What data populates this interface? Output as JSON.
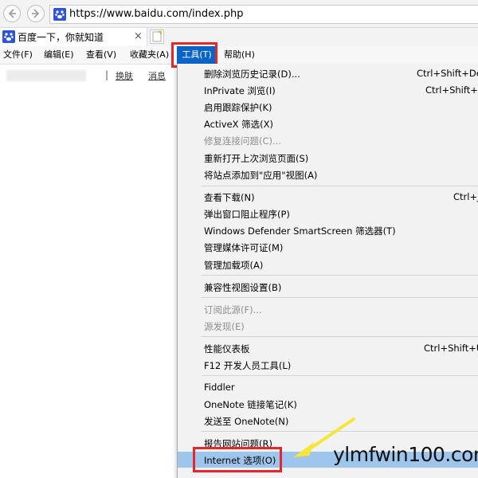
{
  "address_bar": {
    "url": "https://www.baidu.com/index.php"
  },
  "tab": {
    "title": "百度一下，你就知道",
    "close": "×"
  },
  "menubar": [
    {
      "label": "文件(F)"
    },
    {
      "label": "编辑(E)"
    },
    {
      "label": "查看(V)"
    },
    {
      "label": "收藏夹(A)"
    },
    {
      "label": "工具(T)"
    },
    {
      "label": "帮助(H)"
    }
  ],
  "page": {
    "separator": "|",
    "links": [
      "换肤",
      "消息"
    ]
  },
  "tools_menu": {
    "items": [
      {
        "label": "删除浏览历史记录(D)...",
        "shortcut": "Ctrl+Shift+Del"
      },
      {
        "label": "InPrivate 浏览(I)",
        "shortcut": "Ctrl+Shift+P"
      },
      {
        "label": "启用跟踪保护(K)",
        "shortcut": ""
      },
      {
        "label": "ActiveX 筛选(X)",
        "shortcut": ""
      },
      {
        "label": "修复连接问题(C)...",
        "shortcut": ""
      },
      {
        "label": "重新打开上次浏览页面(S)",
        "shortcut": ""
      },
      {
        "label": "将站点添加到\"应用\"视图(A)",
        "shortcut": ""
      },
      {
        "label": "查看下载(N)",
        "shortcut": "Ctrl+J"
      },
      {
        "label": "弹出窗口阻止程序(P)",
        "shortcut": ""
      },
      {
        "label": "Windows Defender SmartScreen 筛选器(T)",
        "shortcut": ""
      },
      {
        "label": "管理媒体许可证(M)",
        "shortcut": ""
      },
      {
        "label": "管理加载项(A)",
        "shortcut": ""
      },
      {
        "label": "兼容性视图设置(B)",
        "shortcut": ""
      },
      {
        "label": "订阅此源(F)...",
        "shortcut": ""
      },
      {
        "label": "源发现(E)",
        "shortcut": ""
      },
      {
        "label": "性能仪表板",
        "shortcut": "Ctrl+Shift+U"
      },
      {
        "label": "F12 开发人员工具(L)",
        "shortcut": ""
      },
      {
        "label": "Fiddler",
        "shortcut": ""
      },
      {
        "label": "OneNote 链接笔记(K)",
        "shortcut": ""
      },
      {
        "label": "发送至 OneNote(N)",
        "shortcut": ""
      },
      {
        "label": "报告网站问题(R)",
        "shortcut": ""
      },
      {
        "label": "Internet 选项(O)",
        "shortcut": ""
      }
    ]
  },
  "watermark": "ylmfwin100.com",
  "colors": {
    "menu_active": "#0a64c8",
    "selected_item": "#9ec6ec",
    "highlight_box": "#e5262b",
    "arrow": "#f5e63a"
  }
}
